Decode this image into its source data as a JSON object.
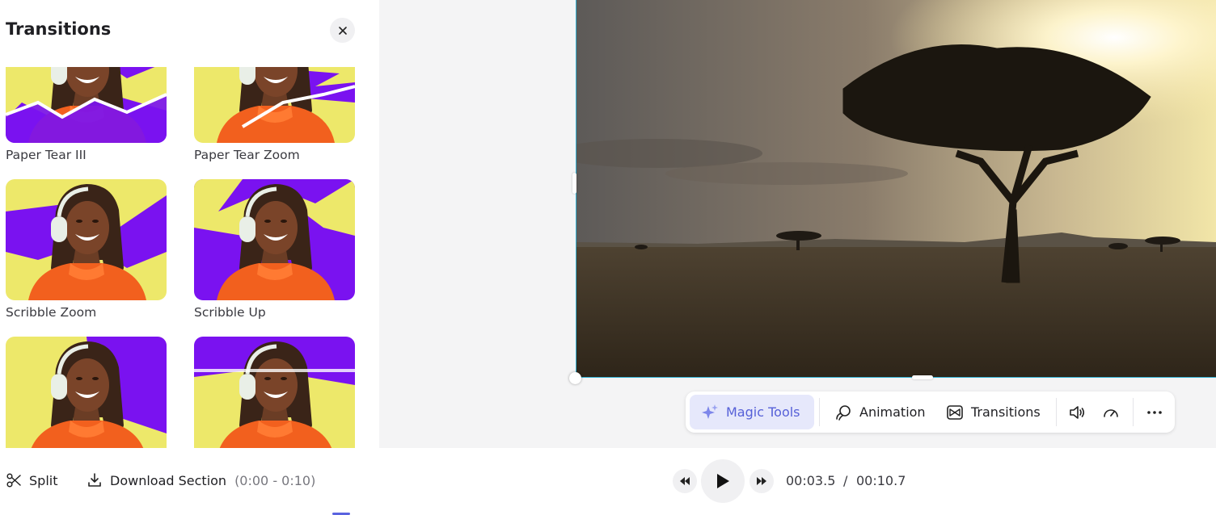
{
  "panel": {
    "title": "Transitions",
    "items": [
      {
        "label": "Paper Tear III"
      },
      {
        "label": "Paper Tear Zoom"
      },
      {
        "label": "Scribble Zoom"
      },
      {
        "label": "Scribble Up"
      },
      {
        "label": ""
      },
      {
        "label": ""
      }
    ]
  },
  "toolbar": {
    "magic_tools": "Magic Tools",
    "animation": "Animation",
    "transitions": "Transitions"
  },
  "bottom": {
    "split": "Split",
    "download": "Download Section",
    "range": "(0:00 - 0:10)",
    "current_time": "00:03.5",
    "separator": "/",
    "total_time": "00:10.7"
  },
  "colors": {
    "accent": "#5660d8",
    "accent_bg": "#e6e8fb",
    "purple": "#7a12f0",
    "yellow": "#ede86a",
    "selection": "#35b3d6"
  },
  "icons": [
    "close-icon",
    "sparkle-icon",
    "animation-icon",
    "transitions-icon",
    "volume-icon",
    "speed-icon",
    "more-icon",
    "scissors-icon",
    "download-icon",
    "rewind-icon",
    "play-icon",
    "fast-forward-icon"
  ]
}
